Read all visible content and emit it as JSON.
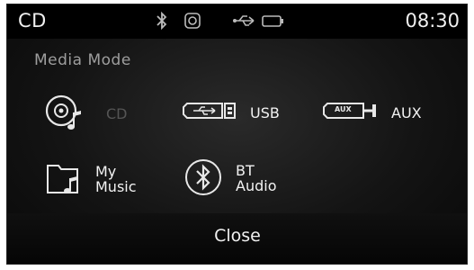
{
  "status_bar": {
    "mode": "CD",
    "time": "08:30",
    "icons": [
      "bluetooth-icon",
      "settings-icon",
      "usb-icon",
      "battery-icon"
    ]
  },
  "panel": {
    "heading": "Media Mode",
    "items": [
      {
        "label": "CD",
        "icon": "cd-icon",
        "enabled": false
      },
      {
        "label": "USB",
        "icon": "usb-icon",
        "enabled": true
      },
      {
        "label": "AUX",
        "icon": "aux-icon",
        "enabled": true
      },
      {
        "label": "My\nMusic",
        "icon": "folder-music-icon",
        "enabled": true
      },
      {
        "label": "BT\nAudio",
        "icon": "bluetooth-icon",
        "enabled": true
      }
    ],
    "aux_icon_text": "AUX"
  },
  "footer": {
    "close_label": "Close"
  },
  "colors": {
    "background": "#0c0c0c",
    "text": "#f0f0f0",
    "heading": "#9e9e9e",
    "disabled": "#555555"
  }
}
